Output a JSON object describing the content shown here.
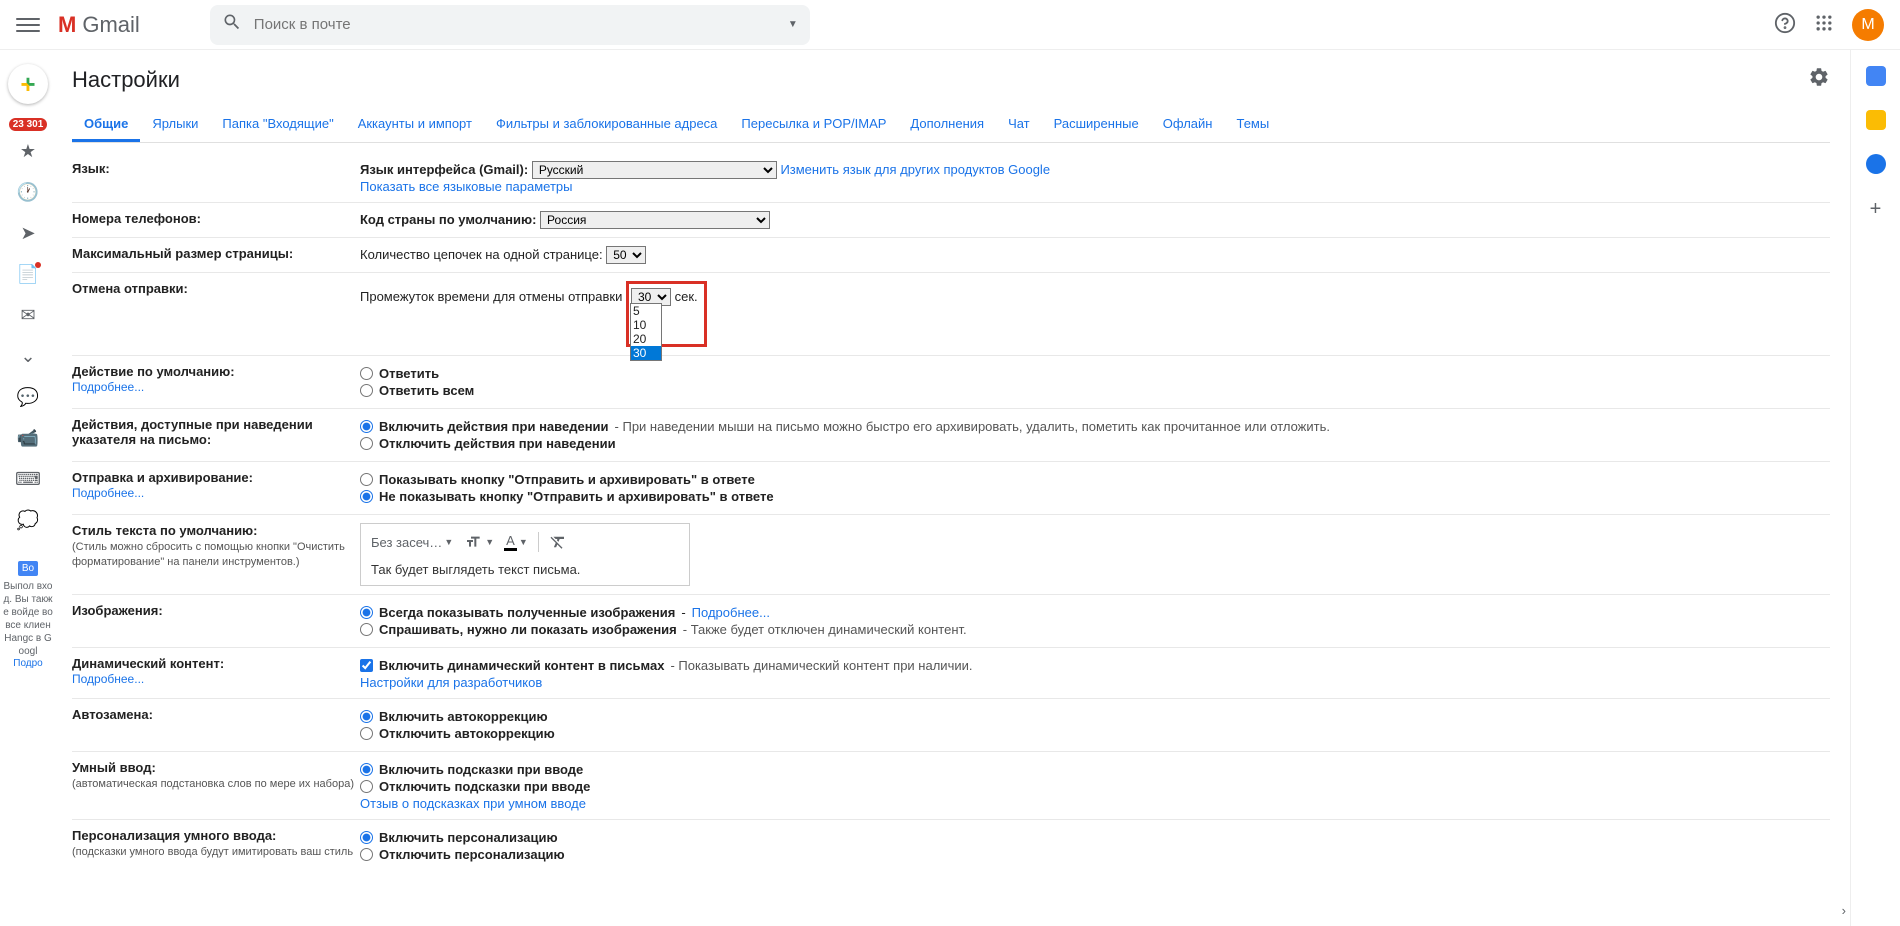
{
  "header": {
    "logo_text": "Gmail",
    "search_placeholder": "Поиск в почте",
    "avatar_letter": "M"
  },
  "sidebar": {
    "badge": "23 301",
    "hangouts_badge": "Во",
    "hangouts_text": "Выпол вход. Вы также войде во все клиен Hangc в Googl",
    "hangouts_link": "Подро"
  },
  "page": {
    "title": "Настройки"
  },
  "tabs": [
    "Общие",
    "Ярлыки",
    "Папка \"Входящие\"",
    "Аккаунты и импорт",
    "Фильтры и заблокированные адреса",
    "Пересылка и POP/IMAP",
    "Дополнения",
    "Чат",
    "Расширенные",
    "Офлайн",
    "Темы"
  ],
  "settings": {
    "language": {
      "label": "Язык:",
      "interface_label": "Язык интерфейса (Gmail):",
      "interface_value": "Русский",
      "change_link": "Изменить язык для других продуктов Google",
      "show_all": "Показать все языковые параметры"
    },
    "phone": {
      "label": "Номера телефонов:",
      "country_label": "Код страны по умолчанию:",
      "country_value": "Россия"
    },
    "page_size": {
      "label": "Максимальный размер страницы:",
      "threads_label": "Количество цепочек на одной странице:",
      "threads_value": "50"
    },
    "undo": {
      "label": "Отмена отправки:",
      "interval_label": "Промежуток времени для отмены отправки",
      "value": "30",
      "suffix": "сек.",
      "options": [
        "5",
        "10",
        "20",
        "30"
      ]
    },
    "default_action": {
      "label": "Действие по умолчанию:",
      "details": "Подробнее...",
      "reply": "Ответить",
      "reply_all": "Ответить всем"
    },
    "hover": {
      "label": "Действия, доступные при наведении указателя на письмо:",
      "enable": "Включить действия при наведении",
      "enable_hint": " - При наведении мыши на письмо можно быстро его архивировать, удалить, пометить как прочитанное или отложить.",
      "disable": "Отключить действия при наведении"
    },
    "archive": {
      "label": "Отправка и архивирование:",
      "details": "Подробнее...",
      "show": "Показывать кнопку \"Отправить и архивировать\" в ответе",
      "hide": "Не показывать кнопку \"Отправить и архивировать\" в ответе"
    },
    "text_style": {
      "label": "Стиль текста по умолчанию:",
      "sublabel": "(Стиль можно сбросить с помощью кнопки \"Очистить форматирование\" на панели инструментов.)",
      "font": "Без засеч…",
      "preview": "Так будет выглядеть текст письма."
    },
    "images": {
      "label": "Изображения:",
      "always": "Всегда показывать полученные изображения",
      "always_link": "Подробнее...",
      "ask": "Спрашивать, нужно ли показать изображения",
      "ask_hint": " - Также будет отключен динамический контент."
    },
    "dynamic": {
      "label": "Динамический контент:",
      "details": "Подробнее...",
      "enable": "Включить динамический контент в письмах",
      "hint": " - Показывать динамический контент при наличии.",
      "dev_link": "Настройки для разработчиков"
    },
    "autocorrect": {
      "label": "Автозамена:",
      "enable": "Включить автокоррекцию",
      "disable": "Отключить автокоррекцию"
    },
    "smart_compose": {
      "label": "Умный ввод:",
      "sublabel": "(автоматическая подстановка слов по мере их набора)",
      "enable": "Включить подсказки при вводе",
      "disable": "Отключить подсказки при вводе",
      "feedback": "Отзыв о подсказках при умном вводе"
    },
    "personalization": {
      "label": "Персонализация умного ввода:",
      "sublabel": "(подсказки умного ввода будут имитировать ваш стиль",
      "enable": "Включить персонализацию",
      "disable": "Отключить персонализацию"
    }
  }
}
